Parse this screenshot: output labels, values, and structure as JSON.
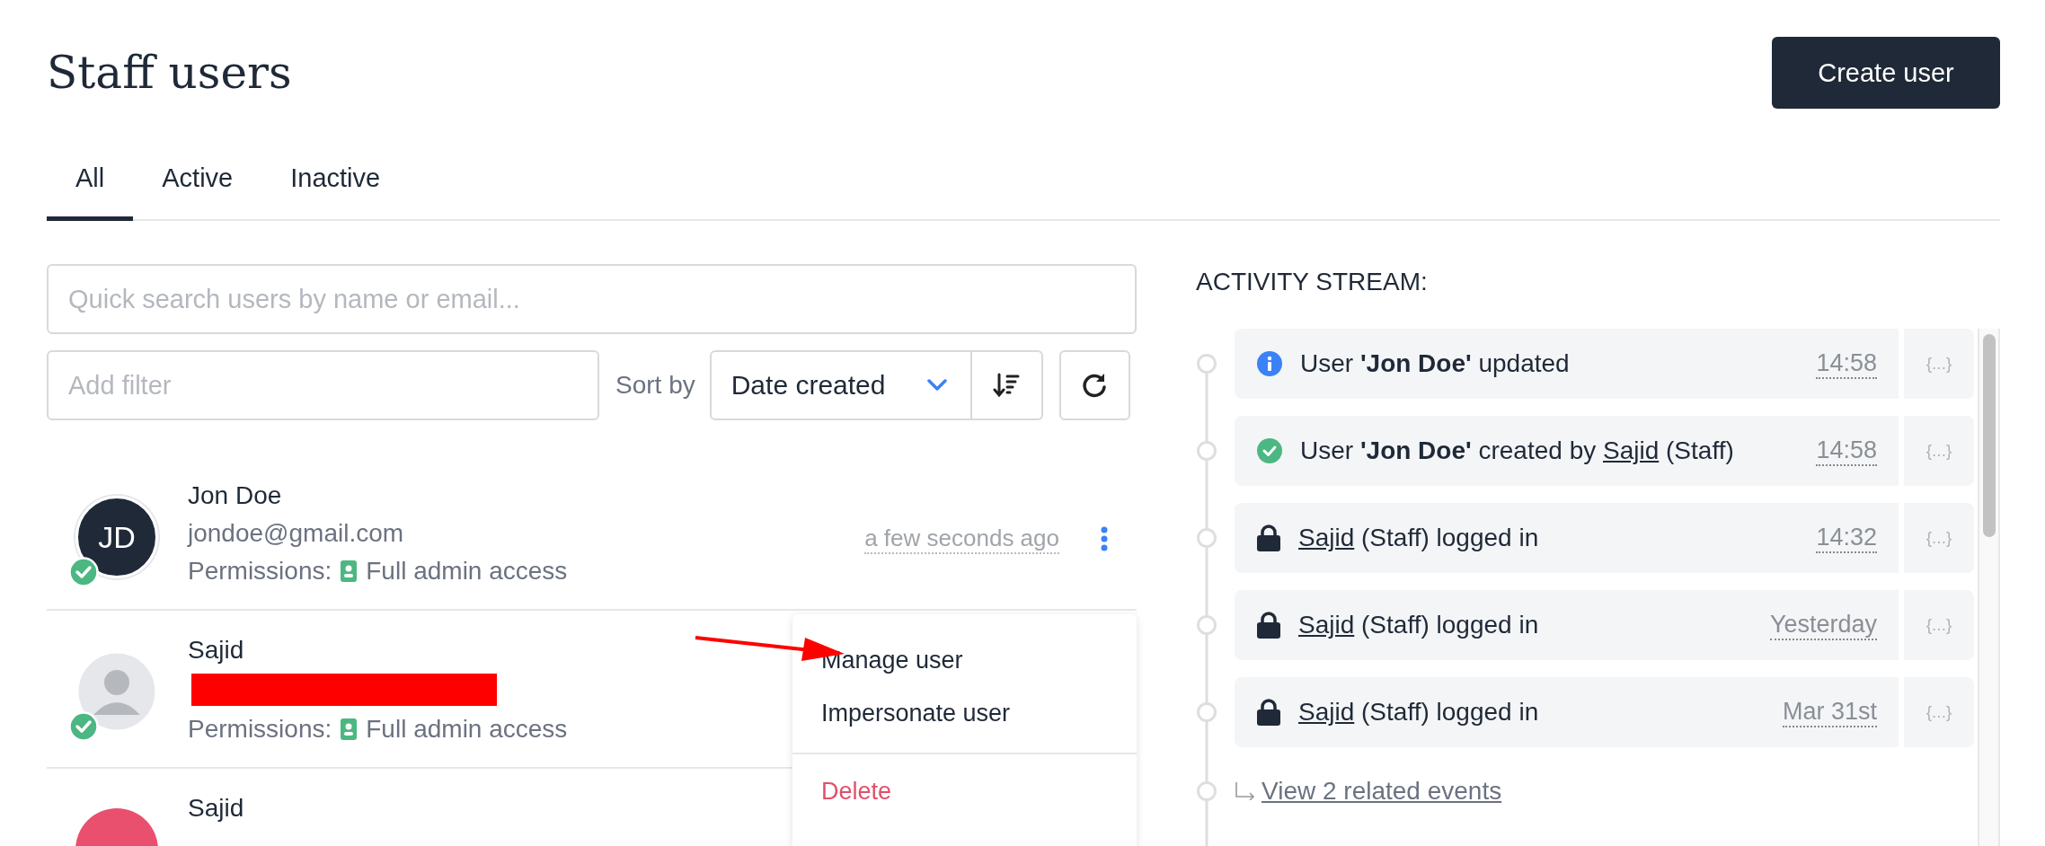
{
  "title": "Staff users",
  "create_button": "Create user",
  "tabs": [
    {
      "label": "All",
      "selected": true
    },
    {
      "label": "Active",
      "selected": false
    },
    {
      "label": "Inactive",
      "selected": false
    }
  ],
  "search": {
    "placeholder": "Quick search users by name or email..."
  },
  "filter": {
    "placeholder": "Add filter"
  },
  "sort": {
    "label": "Sort by",
    "value": "Date created"
  },
  "users": [
    {
      "name": "Jon Doe",
      "email": "jondoe@gmail.com",
      "kind": "initials",
      "initials": "JD",
      "active": true,
      "permissions_label": "Permissions:",
      "permission": "Full admin access",
      "time": "a few seconds ago"
    },
    {
      "name": "Sajid",
      "kind": "silhouette",
      "active": true,
      "permissions_label": "Permissions:",
      "permission": "Full admin access",
      "redacted": true
    },
    {
      "name": "Sajid",
      "kind": "color",
      "color": "#e8506e"
    }
  ],
  "menu": [
    {
      "label": "Manage user",
      "kind": "normal"
    },
    {
      "label": "Impersonate user",
      "kind": "normal"
    },
    {
      "label": "Delete",
      "kind": "danger"
    }
  ],
  "activity": {
    "title": "ACTIVITY STREAM:",
    "events": [
      {
        "kind": "info",
        "parts": [
          {
            "kind": "text",
            "text": "User "
          },
          {
            "kind": "bold",
            "text": "'Jon Doe'"
          },
          {
            "kind": "text",
            "text": " updated"
          }
        ],
        "time": "14:58",
        "json": "{...}"
      },
      {
        "kind": "check",
        "parts": [
          {
            "kind": "text",
            "text": "User "
          },
          {
            "kind": "bold",
            "text": "'Jon Doe'"
          },
          {
            "kind": "text",
            "text": " created by "
          },
          {
            "kind": "link",
            "text": "Sajid"
          },
          {
            "kind": "text",
            "text": " (Staff)"
          }
        ],
        "time": "14:58",
        "json": "{...}"
      },
      {
        "kind": "lock",
        "parts": [
          {
            "kind": "link",
            "text": "Sajid"
          },
          {
            "kind": "text",
            "text": " (Staff) logged in"
          }
        ],
        "time": "14:32",
        "json": "{...}"
      },
      {
        "kind": "lock",
        "parts": [
          {
            "kind": "link",
            "text": "Sajid"
          },
          {
            "kind": "text",
            "text": " (Staff) logged in"
          }
        ],
        "time": "Yesterday",
        "json": "{...}"
      },
      {
        "kind": "lock",
        "parts": [
          {
            "kind": "link",
            "text": "Sajid"
          },
          {
            "kind": "text",
            "text": " (Staff) logged in"
          }
        ],
        "time": "Mar 31st",
        "json": "{...}"
      }
    ],
    "related_link": "View 2 related events"
  }
}
